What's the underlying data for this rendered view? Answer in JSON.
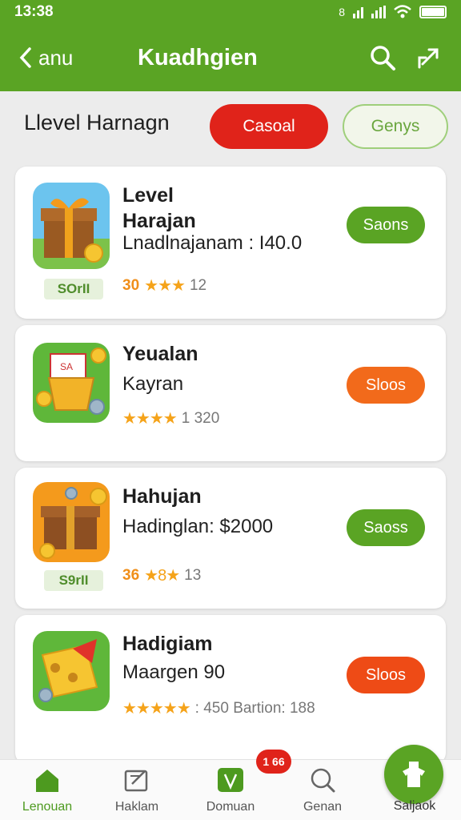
{
  "status_bar": {
    "time": "13:38",
    "right_text": "8"
  },
  "app_bar": {
    "back_label": "anu",
    "title": "Kuadhgien",
    "icons": [
      "chevron-left-icon",
      "search-icon",
      "share-icon"
    ]
  },
  "filter": {
    "title": "Llevel Harnagn",
    "chips": [
      {
        "label": "Casoal",
        "selected": true
      },
      {
        "label": "Genys",
        "selected": false
      }
    ]
  },
  "cards": [
    {
      "name_line1": "Level",
      "name_line2": "Harajan",
      "subtitle": "Lnadlnajanam : I40.0",
      "tag": "SOrII",
      "rating_value": "30",
      "stars": "★★★",
      "rating_count": "12",
      "button_label": "Saons",
      "button_color": "#5aa424",
      "icon": "gift-box-icon"
    },
    {
      "name_line1": "Yeualan",
      "subtitle": "Kayran",
      "tag": "",
      "rating_value": "",
      "stars": "★★★★",
      "rating_count": "1 320",
      "button_label": "Sloos",
      "button_color": "#f26a1b",
      "icon": "coin-bucket-icon"
    },
    {
      "name_line1": "Hahujan",
      "subtitle": "Hadinglan: $2000",
      "tag": "S9rII",
      "rating_value": "36",
      "stars": "★8★",
      "rating_count": "13",
      "button_label": "Saoss",
      "button_color": "#5aa424",
      "icon": "treasure-chest-icon"
    },
    {
      "name_line1": "Hadigiam",
      "subtitle": "Maargen 90",
      "tag": "",
      "rating_value": "",
      "stars": "★★★★★",
      "rating_count": ": 450 Bartion: 188",
      "button_label": "Sloos",
      "button_color": "#ee4b16",
      "icon": "envelope-card-icon"
    }
  ],
  "bottom_nav": {
    "items": [
      {
        "label": "Lenouan",
        "icon": "home-icon",
        "active": true
      },
      {
        "label": "Haklam",
        "icon": "edit-icon",
        "active": false
      },
      {
        "label": "Domuan",
        "icon": "leaf-icon",
        "active": false
      },
      {
        "label": "Genan",
        "icon": "search-icon",
        "active": false
      }
    ],
    "badge": "1 66",
    "fab_label": "Saljaok",
    "fab_icon": "shirt-icon"
  },
  "colors": {
    "brand_green": "#5aa424",
    "accent_red": "#e0231a",
    "accent_orange": "#f26a1b",
    "star": "#f5a31a"
  }
}
